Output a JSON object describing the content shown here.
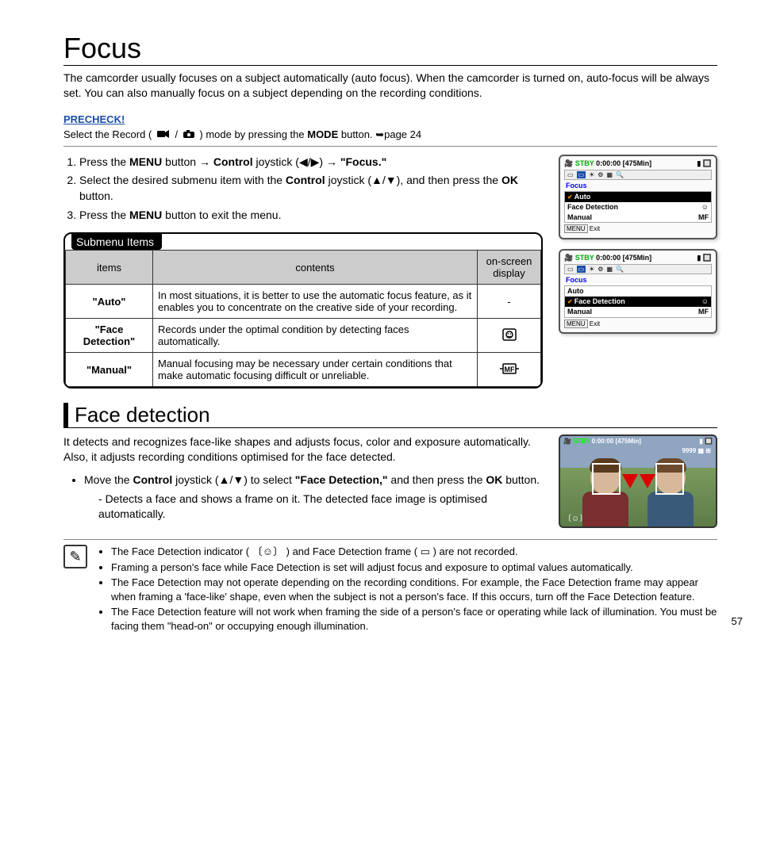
{
  "title": "Focus",
  "intro": "The camcorder usually focuses on a subject automatically (auto focus). When the camcorder is turned on, auto-focus will be always set. You can also manually focus on a subject depending on the recording conditions.",
  "precheck": {
    "label": "PRECHECK!",
    "prefix": "Select the Record ( ",
    "mid": " ) mode by pressing the ",
    "mode": "MODE",
    "suffix": " button. ➥page 24"
  },
  "steps": [
    {
      "pre": "Press the ",
      "b1": "MENU",
      "mid1": " button → ",
      "b2": "Control",
      "mid2": " joystick (◀/▶) → ",
      "b3": "\"Focus.\"",
      "tail": ""
    },
    {
      "pre": "Select the desired submenu item with the ",
      "b1": "Control",
      "mid1": " joystick (▲/▼), and then press the ",
      "b2": "OK",
      "mid2": " button.",
      "b3": "",
      "tail": ""
    },
    {
      "pre": "Press the ",
      "b1": "MENU",
      "mid1": " button to exit the menu.",
      "b2": "",
      "mid2": "",
      "b3": "",
      "tail": ""
    }
  ],
  "submenu": {
    "tab": "Submenu Items",
    "headers": [
      "items",
      "contents",
      "on-screen display"
    ],
    "rows": [
      {
        "item": "\"Auto\"",
        "content": "In most situations, it is better to use the automatic focus feature, as it enables you to concentrate on the creative side of your recording.",
        "osd": "-"
      },
      {
        "item": "\"Face Detection\"",
        "content": "Records under the optimal condition by detecting faces automatically.",
        "osd": "face"
      },
      {
        "item": "\"Manual\"",
        "content": "Manual focusing may be necessary under certain conditions that make automatic focusing difficult or unreliable.",
        "osd": "mf"
      }
    ]
  },
  "face": {
    "title": "Face detection",
    "body": "It detects and recognizes face-like shapes and adjusts focus, color and exposure automatically. Also, it adjusts recording conditions optimised for the face detected.",
    "bullet_pre": "Move the ",
    "ctrl": "Control",
    "bullet_mid": " joystick (▲/▼) to select ",
    "fd": "\"Face Detection,\"",
    "bullet_mid2": " and then press the ",
    "ok": "OK",
    "bullet_tail": " button.",
    "dash": "Detects a face and shows a frame on it. The detected face image is optimised automatically."
  },
  "notes": [
    "The Face Detection indicator ( 〔☺〕 ) and Face Detection frame ( ▭ ) are not recorded.",
    "Framing a person's face while Face Detection is set will adjust focus and exposure to optimal values automatically.",
    "The Face Detection may not operate depending on the recording conditions. For example, the Face Detection frame may appear when framing a 'face-like' shape, even when the subject is not a person's face. If this occurs, turn off the Face Detection feature.",
    "The Face Detection feature will not work when framing the side of a person's face or operating while lack of illumination. You must be facing them \"head-on\" or occupying enough illumination."
  ],
  "screens": {
    "stby": "STBY",
    "time": "0:00:00 [475Min]",
    "focus": "Focus",
    "auto": "Auto",
    "fd": "Face Detection",
    "manual": "Manual",
    "menu": "MENU",
    "exit": "Exit",
    "count": "9999"
  },
  "page": "57"
}
